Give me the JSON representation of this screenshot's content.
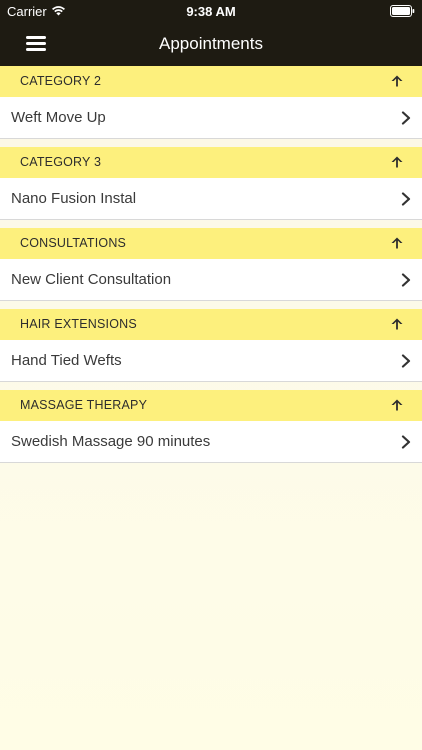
{
  "status_bar": {
    "carrier": "Carrier",
    "time": "9:38 AM"
  },
  "nav": {
    "title": "Appointments"
  },
  "colors": {
    "nav_bg": "#1e1b12",
    "category_bg": "#fdf07d",
    "page_bg": "#fdfbe9"
  },
  "icons": {
    "menu": "hamburger-menu-icon",
    "collapse": "arrow-up-icon",
    "row": "chevron-right-icon"
  },
  "categories": [
    {
      "label": "CATEGORY 2",
      "items": [
        {
          "label": "Weft Move Up"
        }
      ]
    },
    {
      "label": "CATEGORY 3",
      "items": [
        {
          "label": "Nano Fusion Instal"
        }
      ]
    },
    {
      "label": "CONSULTATIONS",
      "items": [
        {
          "label": "New Client Consultation"
        }
      ]
    },
    {
      "label": "HAIR EXTENSIONS",
      "items": [
        {
          "label": "Hand Tied Wefts"
        }
      ]
    },
    {
      "label": "MASSAGE THERAPY",
      "items": [
        {
          "label": "Swedish Massage 90 minutes"
        }
      ]
    }
  ]
}
